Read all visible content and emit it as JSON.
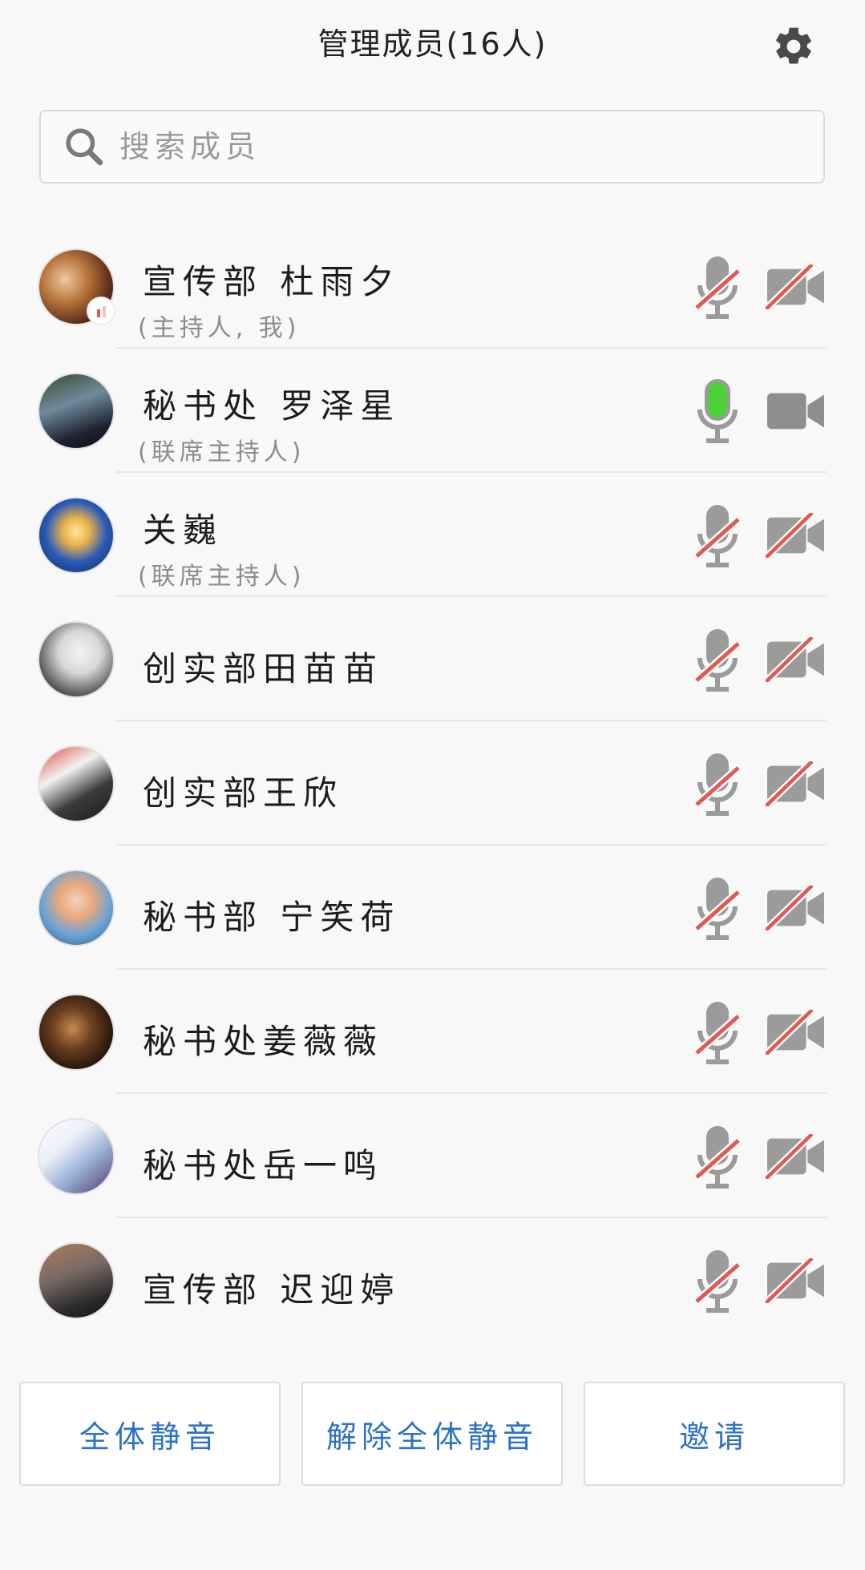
{
  "header": {
    "title": "管理成员(16人)",
    "settings_icon": "gear-icon"
  },
  "search": {
    "placeholder": "搜索成员",
    "value": "",
    "icon": "search-icon"
  },
  "members": [
    {
      "name": "宣传部 杜雨夕",
      "role": "(主持人, 我)",
      "mic": "muted",
      "camera": "off",
      "speaking_badge": true
    },
    {
      "name": "秘书处 罗泽星",
      "role": "(联席主持人)",
      "mic": "active",
      "camera": "on",
      "speaking_badge": false
    },
    {
      "name": "关巍",
      "role": "(联席主持人)",
      "mic": "muted",
      "camera": "off",
      "speaking_badge": false
    },
    {
      "name": "创实部田苗苗",
      "role": "",
      "mic": "muted",
      "camera": "off",
      "speaking_badge": false
    },
    {
      "name": "创实部王欣",
      "role": "",
      "mic": "muted",
      "camera": "off",
      "speaking_badge": false
    },
    {
      "name": "秘书部 宁笑荷",
      "role": "",
      "mic": "muted",
      "camera": "off",
      "speaking_badge": false
    },
    {
      "name": "秘书处姜薇薇",
      "role": "",
      "mic": "muted",
      "camera": "off",
      "speaking_badge": false
    },
    {
      "name": "秘书处岳一鸣",
      "role": "",
      "mic": "muted",
      "camera": "off",
      "speaking_badge": false
    },
    {
      "name": "宣传部 迟迎婷",
      "role": "",
      "mic": "muted",
      "camera": "off",
      "speaking_badge": false
    }
  ],
  "buttons": {
    "mute_all": "全体静音",
    "unmute_all": "解除全体静音",
    "invite": "邀请"
  },
  "colors": {
    "accent_blue": "#2b72c6",
    "mic_active_green": "#4cd137",
    "muted_slash_red": "#e05a50",
    "icon_gray": "#9b9b9b",
    "camera_on_gray": "#8e8e8e"
  }
}
